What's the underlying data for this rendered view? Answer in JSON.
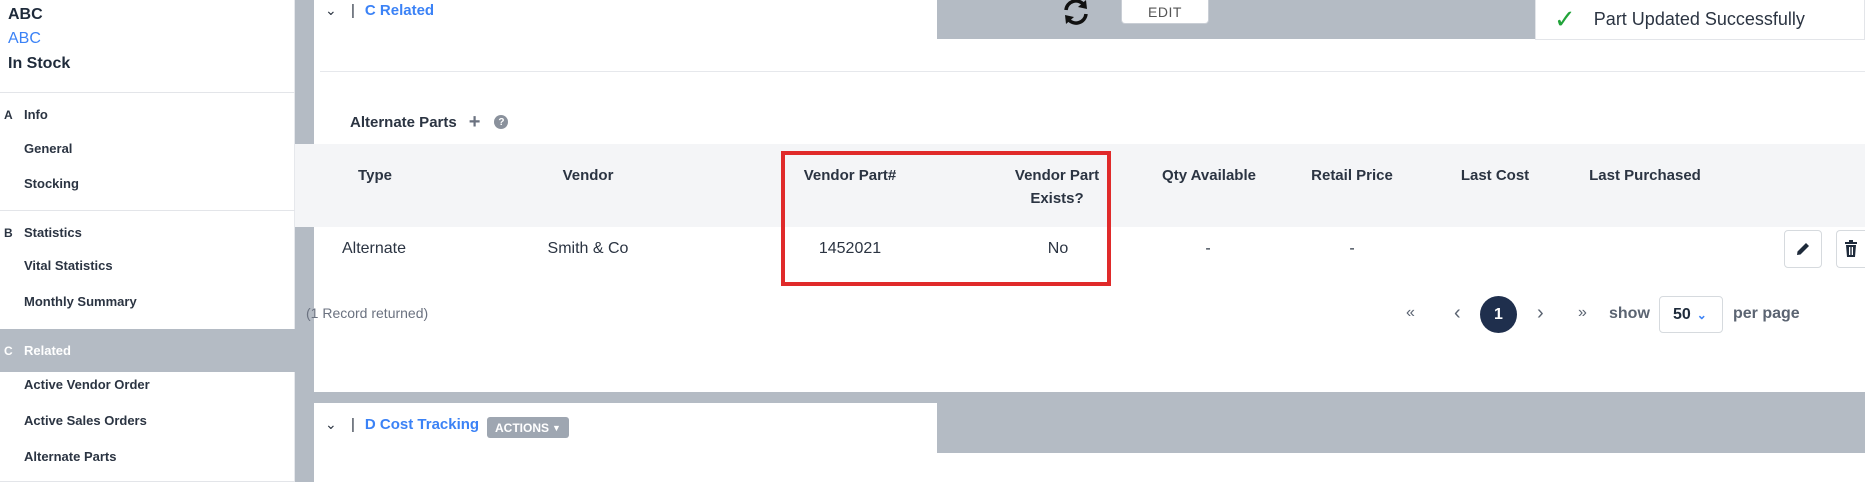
{
  "sidebar": {
    "title_lines": [
      "ABC",
      "ABC",
      "In Stock"
    ],
    "sections": [
      {
        "letter": "A",
        "label": "Info",
        "items": [
          "General",
          "Stocking"
        ]
      },
      {
        "letter": "B",
        "label": "Statistics",
        "items": [
          "Vital Statistics",
          "Monthly Summary"
        ]
      },
      {
        "letter": "C",
        "label": "Related",
        "items": [
          "Active Vendor Order",
          "Active Sales Orders",
          "Alternate Parts"
        ]
      }
    ]
  },
  "header": {
    "section_c_title": "C Related",
    "edit_label": "EDIT",
    "toast_message": "Part Updated Successfully",
    "refresh_icon": "refresh-icon",
    "check_icon": "check-icon"
  },
  "alternate_parts": {
    "title": "Alternate Parts",
    "columns": [
      "Type",
      "Vendor",
      "Vendor Part#",
      "Vendor Part Exists?",
      "Qty Available",
      "Retail Price",
      "Last Cost",
      "Last Purchased"
    ],
    "rows": [
      {
        "type": "Alternate",
        "vendor": "Smith & Co",
        "vendor_part": "1452021",
        "exists": "No",
        "qty": "-",
        "retail": "-",
        "last_cost": "",
        "last_purchased": ""
      }
    ],
    "records_text": "(1 Record returned)"
  },
  "pagination": {
    "first": "«",
    "prev": "‹",
    "current": "1",
    "next": "›",
    "last": "»",
    "show_label": "show",
    "per_page_value": "50",
    "per_page_label": "per page"
  },
  "section_d": {
    "title": "D Cost Tracking",
    "actions_label": "ACTIONS"
  },
  "colors": {
    "accent_blue": "#3b82f6",
    "highlight_red": "#e02a2a",
    "band_gray": "#b4bbc4",
    "page_active": "#1f2f4d",
    "success_green": "#22a33a"
  }
}
